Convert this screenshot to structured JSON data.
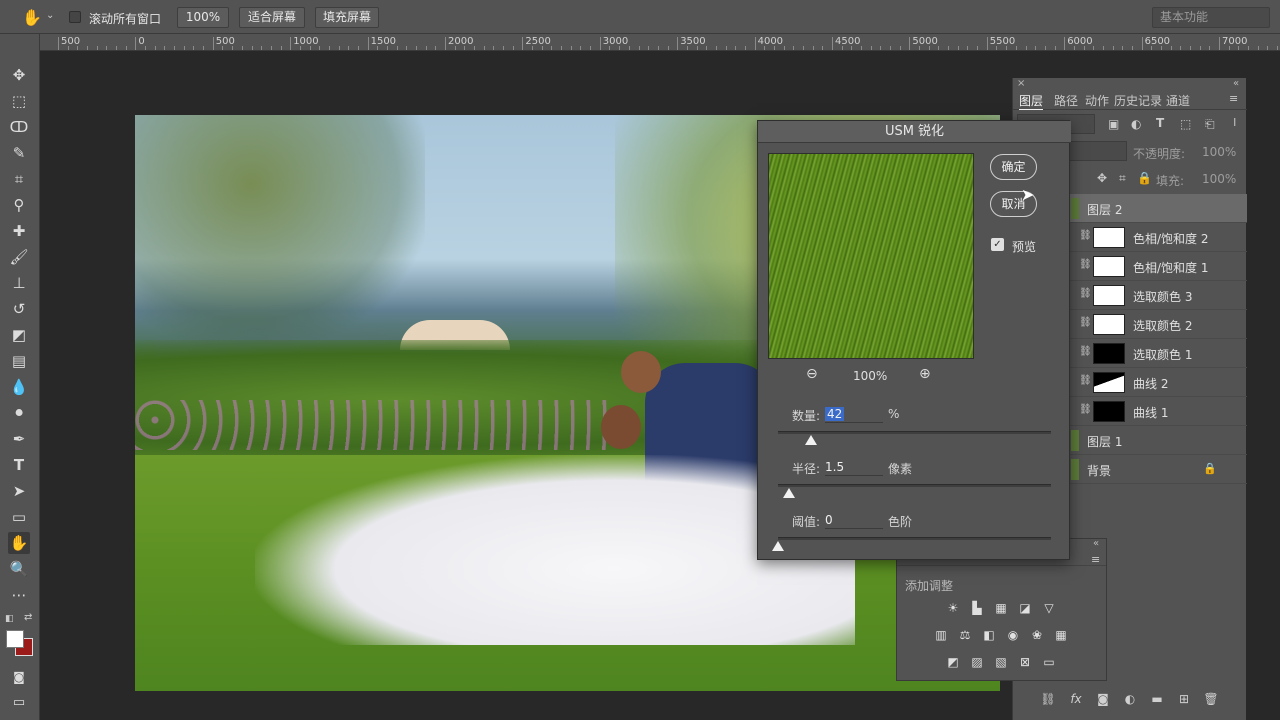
{
  "options_bar": {
    "scroll_all_label": "滚动所有窗口",
    "zoom_value": "100%",
    "fit_screen_label": "适合屏幕",
    "fill_screen_label": "填充屏幕",
    "workspace_value": "基本功能"
  },
  "ruler": {
    "labels": [
      "500",
      "0",
      "500",
      "1000",
      "1500",
      "2000",
      "2500",
      "3000",
      "3500",
      "4000",
      "4500",
      "5000",
      "5500",
      "6000",
      "6500",
      "7000"
    ]
  },
  "dialog": {
    "title": "USM 锐化",
    "ok_label": "确定",
    "cancel_label": "取消",
    "preview_label": "预览",
    "zoom_value": "100%",
    "amount": {
      "label": "数量:",
      "value": "42",
      "unit": "%",
      "fraction": 0.12
    },
    "radius": {
      "label": "半径:",
      "value": "1.5",
      "unit": "像素",
      "fraction": 0.04
    },
    "threshold": {
      "label": "阈值:",
      "value": "0",
      "unit": "色阶",
      "fraction": 0.0
    }
  },
  "layers_panel": {
    "tabs": [
      "图层",
      "路径",
      "动作",
      "历史记录",
      "通道"
    ],
    "opacity_label": "不透明度:",
    "opacity_value": "100%",
    "fill_label": "填充:",
    "fill_value": "100%",
    "layers": [
      {
        "name": "图层 2",
        "thumb": "photo",
        "selected": true
      },
      {
        "name": "色相/饱和度 2",
        "thumb": "white"
      },
      {
        "name": "色相/饱和度 1",
        "thumb": "white"
      },
      {
        "name": "选取颜色 3",
        "thumb": "white"
      },
      {
        "name": "选取颜色 2",
        "thumb": "white"
      },
      {
        "name": "选取颜色 1",
        "thumb": "black"
      },
      {
        "name": "曲线 2",
        "thumb": "mixed"
      },
      {
        "name": "曲线 1",
        "thumb": "black"
      },
      {
        "name": "图层 1",
        "thumb": "photo"
      },
      {
        "name": "背景",
        "thumb": "photo",
        "locked": true
      }
    ]
  },
  "adjustments_panel": {
    "add_adjustment_label": "添加调整"
  },
  "colors": {
    "panel_bg": "#535353",
    "canvas_bg": "#282828",
    "selection_blue": "#3b6bc9",
    "bg_swatch": "#9b1a1a"
  }
}
